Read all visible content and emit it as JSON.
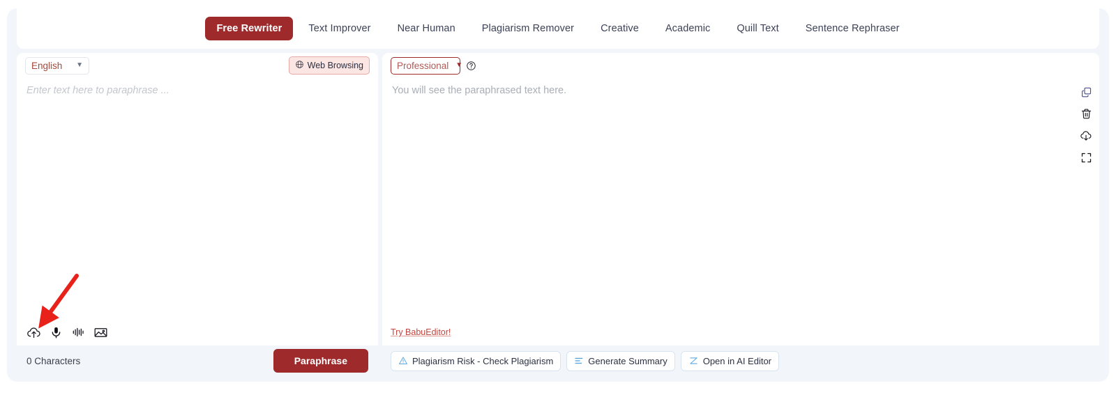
{
  "tabs": [
    {
      "label": "Free Rewriter",
      "active": true
    },
    {
      "label": "Text Improver",
      "active": false
    },
    {
      "label": "Near Human",
      "active": false
    },
    {
      "label": "Plagiarism Remover",
      "active": false
    },
    {
      "label": "Creative",
      "active": false
    },
    {
      "label": "Academic",
      "active": false
    },
    {
      "label": "Quill Text",
      "active": false
    },
    {
      "label": "Sentence Rephraser",
      "active": false
    }
  ],
  "left_panel": {
    "language_select": "English",
    "web_browsing_label": "Web Browsing",
    "input_placeholder": "Enter text here to paraphrase ...",
    "tools": [
      {
        "name": "cloud-upload-icon"
      },
      {
        "name": "microphone-icon"
      },
      {
        "name": "audio-waveform-icon"
      },
      {
        "name": "image-icon"
      }
    ],
    "character_count": "0 Characters",
    "paraphrase_label": "Paraphrase"
  },
  "right_panel": {
    "tone_select": "Professional",
    "help_icon": "help-circle-icon",
    "output_placeholder": "You will see the paraphrased text here.",
    "rail_icons": [
      {
        "name": "copy-icon"
      },
      {
        "name": "trash-icon"
      },
      {
        "name": "cloud-download-icon"
      },
      {
        "name": "fullscreen-icon"
      }
    ],
    "try_link": "Try BabuEditor!",
    "actions": [
      {
        "label": "Plagiarism Risk - Check Plagiarism",
        "icon": "warning-triangle-icon"
      },
      {
        "label": "Generate Summary",
        "icon": "summary-lines-icon"
      },
      {
        "label": "Open in AI Editor",
        "icon": "ai-editor-icon"
      }
    ]
  },
  "annotation": {
    "arrow": "red-arrow-pointing-to-microphone"
  },
  "colors": {
    "brand_red": "#9e2a2b",
    "page_bg": "#f2f6fa",
    "annotation_red": "#e8211a",
    "link_red": "#c2453f",
    "icon_blue": "#5ea8e0"
  }
}
